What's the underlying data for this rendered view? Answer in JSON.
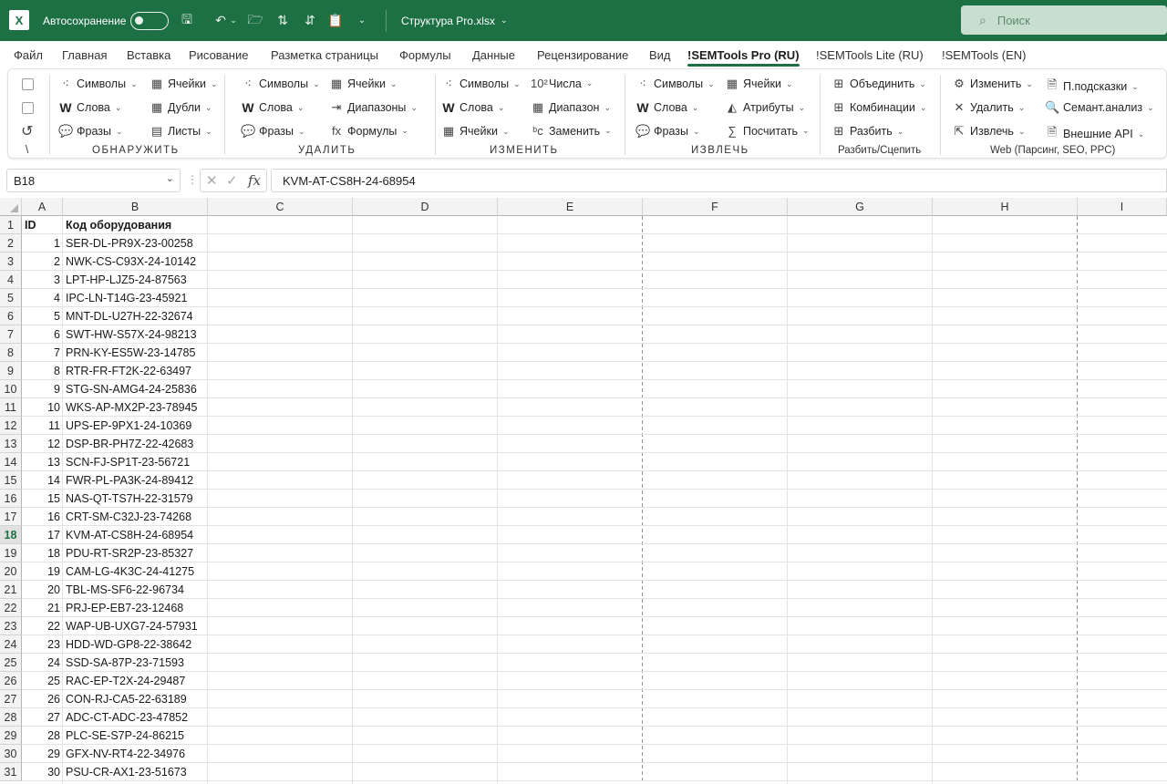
{
  "titlebar": {
    "logo": "X",
    "autosave_label": "Автосохранение",
    "filename": "Структура Pro.xlsx",
    "search_placeholder": "Поиск"
  },
  "menu": [
    "Файл",
    "Главная",
    "Вставка",
    "Рисование",
    "Разметка страницы",
    "Формулы",
    "Данные",
    "Рецензирование",
    "Вид",
    "!SEMTools Pro (RU)",
    "!SEMTools Lite (RU)",
    "!SEMTools (EN)"
  ],
  "menu_active": "!SEMTools Pro (RU)",
  "ribbon": {
    "groups": [
      {
        "label": "ОБНАРУЖИТЬ",
        "buttons": [
          {
            "icon": "symbols-icon",
            "glyph": "⁖",
            "label": "Символы"
          },
          {
            "icon": "words-icon",
            "glyph": "W",
            "label": "Слова"
          },
          {
            "icon": "phrases-icon",
            "glyph": "💬",
            "label": "Фразы"
          },
          {
            "icon": "cells-icon",
            "glyph": "▦",
            "label": "Ячейки"
          },
          {
            "icon": "duplicates-icon",
            "glyph": "▦",
            "label": "Дубли"
          },
          {
            "icon": "sheets-icon",
            "glyph": "▤",
            "label": "Листы"
          }
        ]
      },
      {
        "label": "УДАЛИТЬ",
        "buttons": [
          {
            "icon": "symbols-icon",
            "glyph": "⁖",
            "label": "Символы"
          },
          {
            "icon": "words-icon",
            "glyph": "W",
            "label": "Слова"
          },
          {
            "icon": "phrases-icon",
            "glyph": "💬",
            "label": "Фразы"
          },
          {
            "icon": "cells-icon",
            "glyph": "▦",
            "label": "Ячейки"
          },
          {
            "icon": "ranges-icon",
            "glyph": "⇥",
            "label": "Диапазоны"
          },
          {
            "icon": "formulas-icon",
            "glyph": "fx",
            "label": "Формулы"
          }
        ]
      },
      {
        "label": "ИЗМЕНИТЬ",
        "buttons": [
          {
            "icon": "symbols-icon",
            "glyph": "⁖",
            "label": "Символы"
          },
          {
            "icon": "words-icon",
            "glyph": "W",
            "label": "Слова"
          },
          {
            "icon": "cells-icon",
            "glyph": "▦",
            "label": "Ячейки"
          },
          {
            "icon": "numbers-icon",
            "glyph": "10²",
            "label": "Числа"
          },
          {
            "icon": "range-icon",
            "glyph": "▦",
            "label": "Диапазон"
          },
          {
            "icon": "replace-icon",
            "glyph": "ᵇc",
            "label": "Заменить"
          }
        ]
      },
      {
        "label": "ИЗВЛЕЧЬ",
        "buttons": [
          {
            "icon": "symbols-icon",
            "glyph": "⁖",
            "label": "Символы"
          },
          {
            "icon": "words-icon",
            "glyph": "W",
            "label": "Слова"
          },
          {
            "icon": "phrases-icon",
            "glyph": "💬",
            "label": "Фразы"
          },
          {
            "icon": "cells-icon",
            "glyph": "▦",
            "label": "Ячейки"
          },
          {
            "icon": "attributes-icon",
            "glyph": "◭",
            "label": "Атрибуты"
          },
          {
            "icon": "sum-icon",
            "glyph": "∑",
            "label": "Посчитать"
          }
        ]
      },
      {
        "label": "Разбить/Сцепить",
        "buttons": [
          {
            "icon": "merge-icon",
            "glyph": "⊞",
            "label": "Объединить"
          },
          {
            "icon": "combinations-icon",
            "glyph": "⊞",
            "label": "Комбинации"
          },
          {
            "icon": "split-icon",
            "glyph": "⊞",
            "label": "Разбить"
          }
        ]
      },
      {
        "label": "Web (Парсинг, SEO, PPC)",
        "buttons": [
          {
            "icon": "change-web-icon",
            "glyph": "⚙",
            "label": "Изменить"
          },
          {
            "icon": "delete-web-icon",
            "glyph": "✕",
            "label": "Удалить"
          },
          {
            "icon": "extract-web-icon",
            "glyph": "⇱",
            "label": "Извлечь"
          },
          {
            "icon": "suggest-icon",
            "glyph": "🗎",
            "label": "П.подсказки"
          },
          {
            "icon": "semantic-icon",
            "glyph": "🔍",
            "label": "Семант.анализ"
          },
          {
            "icon": "api-icon",
            "glyph": "🗎",
            "label": "Внешние API"
          }
        ]
      }
    ],
    "misc_label": "\\"
  },
  "formula_bar": {
    "name_box": "B18",
    "fx": "fx",
    "formula": "KVM-AT-CS8H-24-68954"
  },
  "sheet": {
    "columns": [
      "A",
      "B",
      "C",
      "D",
      "E",
      "F",
      "G",
      "H",
      "I"
    ],
    "selected_row": 18,
    "headers": {
      "id": "ID",
      "code": "Код оборудования"
    },
    "rows": [
      {
        "id": "1",
        "code": "SER-DL-PR9X-23-00258"
      },
      {
        "id": "2",
        "code": "NWK-CS-C93X-24-10142"
      },
      {
        "id": "3",
        "code": "LPT-HP-LJZ5-24-87563"
      },
      {
        "id": "4",
        "code": "IPC-LN-T14G-23-45921"
      },
      {
        "id": "5",
        "code": "MNT-DL-U27H-22-32674"
      },
      {
        "id": "6",
        "code": "SWT-HW-S57X-24-98213"
      },
      {
        "id": "7",
        "code": "PRN-KY-ES5W-23-14785"
      },
      {
        "id": "8",
        "code": "RTR-FR-FT2K-22-63497"
      },
      {
        "id": "9",
        "code": "STG-SN-AMG4-24-25836"
      },
      {
        "id": "10",
        "code": "WKS-AP-MX2P-23-78945"
      },
      {
        "id": "11",
        "code": "UPS-EP-9PX1-24-10369"
      },
      {
        "id": "12",
        "code": "DSP-BR-PH7Z-22-42683"
      },
      {
        "id": "13",
        "code": "SCN-FJ-SP1T-23-56721"
      },
      {
        "id": "14",
        "code": "FWR-PL-PA3K-24-89412"
      },
      {
        "id": "15",
        "code": "NAS-QT-TS7H-22-31579"
      },
      {
        "id": "16",
        "code": "CRT-SM-C32J-23-74268"
      },
      {
        "id": "17",
        "code": "KVM-AT-CS8H-24-68954"
      },
      {
        "id": "18",
        "code": "PDU-RT-SR2P-23-85327"
      },
      {
        "id": "19",
        "code": "CAM-LG-4K3C-24-41275"
      },
      {
        "id": "20",
        "code": "TBL-MS-SF6-22-96734"
      },
      {
        "id": "21",
        "code": "PRJ-EP-EB7-23-12468"
      },
      {
        "id": "22",
        "code": "WAP-UB-UXG7-24-57931"
      },
      {
        "id": "23",
        "code": "HDD-WD-GP8-22-38642"
      },
      {
        "id": "24",
        "code": "SSD-SA-87P-23-71593"
      },
      {
        "id": "25",
        "code": "RAC-EP-T2X-24-29487"
      },
      {
        "id": "26",
        "code": "CON-RJ-CA5-22-63189"
      },
      {
        "id": "27",
        "code": "ADC-CT-ADC-23-47852"
      },
      {
        "id": "28",
        "code": "PLC-SE-S7P-24-86215"
      },
      {
        "id": "29",
        "code": "GFX-NV-RT4-22-34976"
      },
      {
        "id": "30",
        "code": "PSU-CR-AX1-23-51673"
      }
    ]
  }
}
